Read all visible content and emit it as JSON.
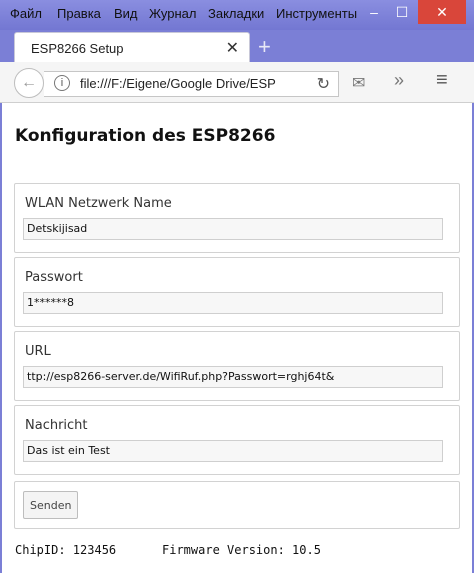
{
  "menu": [
    "Файл",
    "Правка",
    "Вид",
    "Журнал",
    "Закладки",
    "Инструменты"
  ],
  "window": {
    "minimize": "–",
    "maximize": "☐",
    "close": "✕"
  },
  "tab": {
    "title": "ESP8266 Setup",
    "close": "✕",
    "new": "+"
  },
  "toolbar": {
    "url": "file:///F:/Eigene/Google Drive/ESP"
  },
  "page": {
    "title": "Konfiguration des ESP8266",
    "fields": [
      {
        "label": "WLAN Netzwerk Name",
        "value": "Detskijisad"
      },
      {
        "label": "Passwort",
        "value": "1******8"
      },
      {
        "label": "URL",
        "value": "ttp://esp8266-server.de/WifiRuf.php?Passwort=rghj64t&"
      },
      {
        "label": "Nachricht",
        "value": "Das ist ein Test"
      }
    ],
    "send_label": "Senden",
    "chipid": "ChipID: 123456",
    "firmware": "Firmware Version: 10.5"
  },
  "colors": {
    "window_frame": "#7b7fd6",
    "close_button": "#d9463a"
  }
}
